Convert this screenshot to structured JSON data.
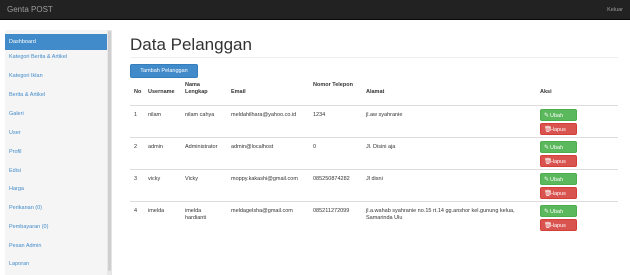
{
  "navbar": {
    "brand": "Genta POST",
    "logout": "Keluar"
  },
  "sidebar": {
    "items": [
      {
        "label": "Dashboard",
        "active": true
      },
      {
        "label": "Kategori Berita & Artikel"
      },
      {
        "label": "Kategori Iklan"
      },
      {
        "label": "Berita & Artikel"
      },
      {
        "label": "Galeri"
      },
      {
        "label": "User"
      },
      {
        "label": "Profil"
      },
      {
        "label": "Edisi"
      },
      {
        "label": "Harga"
      },
      {
        "label": "Perikanan (0)"
      },
      {
        "label": "Pembayaran (0)"
      },
      {
        "label": "Pesan Admin"
      },
      {
        "label": "Laporan"
      }
    ]
  },
  "main": {
    "title": "Data Pelanggan",
    "add_button": "Tambah Pelanggan",
    "columns": [
      "No",
      "Username",
      "Nama Lengkap",
      "Email",
      "Nomor Telepon",
      "Alamat",
      "Aksi"
    ],
    "edit_label": "Ubah",
    "delete_label": "Hapus",
    "rows": [
      {
        "no": "1",
        "username": "nilam",
        "nama": "nilam cahya",
        "email": "meldahilhara@yahoo.co.id",
        "telepon": "1234",
        "alamat": "jl.aw syahranie"
      },
      {
        "no": "2",
        "username": "admin",
        "nama": "Administrator",
        "email": "admin@localhost",
        "telepon": "0",
        "alamat": "Jl. Disini aja"
      },
      {
        "no": "3",
        "username": "vicky",
        "nama": "Vicky",
        "email": "moppy.kakashi@gmail.com",
        "telepon": "085250874282",
        "alamat": "Jl disni"
      },
      {
        "no": "4",
        "username": "imelda",
        "nama": "imelda hardianti",
        "email": "meldagelsha@gmail.com",
        "telepon": "085211272099",
        "alamat": "jl.a.wahab syahranie no.15 rt.14 gg.anshor kel.gunung kelua, Samarinda Ulu"
      }
    ]
  },
  "colors": {
    "primary": "#428bca",
    "success": "#5cb85c",
    "danger": "#d9534f",
    "navbar": "#222222"
  },
  "icons": {
    "edit": "pencil-icon",
    "delete": "trash-icon"
  }
}
